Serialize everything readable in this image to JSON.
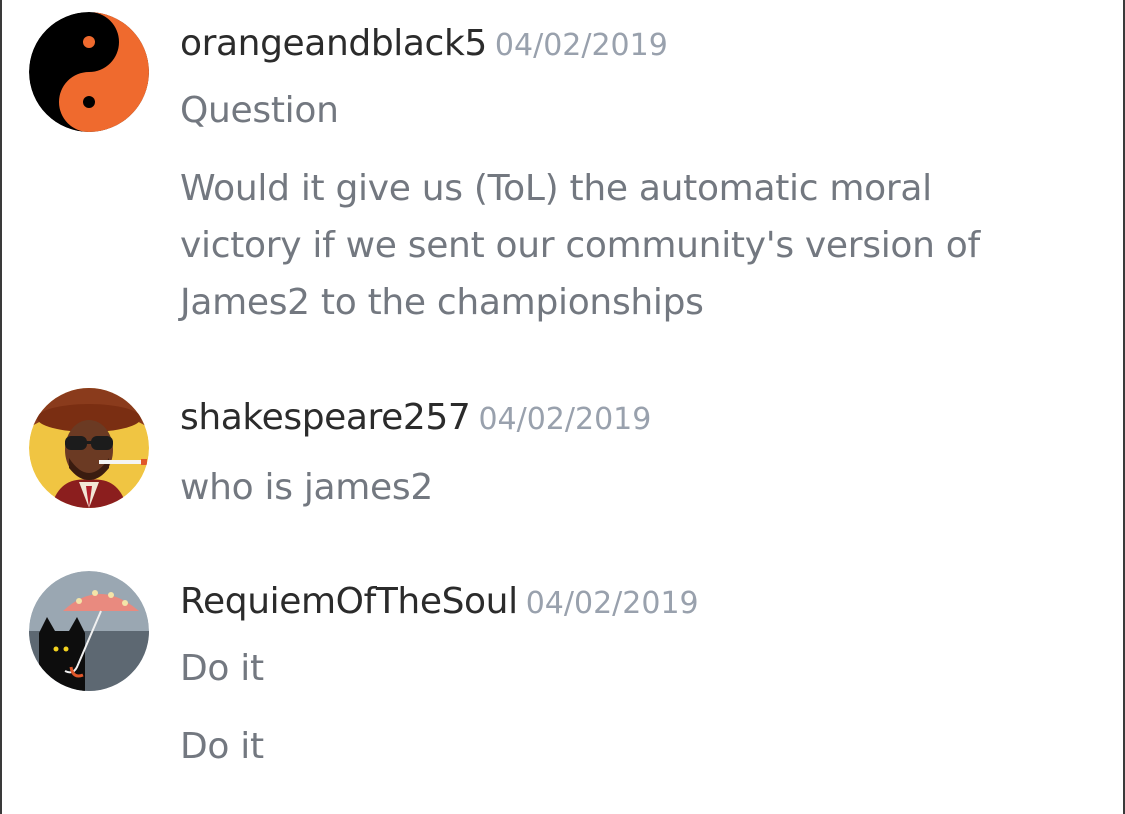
{
  "messages": [
    {
      "username": "orangeandblack5",
      "timestamp": "04/02/2019",
      "avatar_icon": "yin-yang-orange-black",
      "lines": [
        "Question",
        "Would it give us (ToL) the automatic moral victory if we sent our community's version of James2 to the championships"
      ]
    },
    {
      "username": "shakespeare257",
      "timestamp": "04/02/2019",
      "avatar_icon": "man-with-sunglasses-cigarette",
      "lines": [
        "who is james2"
      ]
    },
    {
      "username": "RequiemOfTheSoul",
      "timestamp": "04/02/2019",
      "avatar_icon": "cat-with-umbrella",
      "lines": [
        "Do it",
        "Do it"
      ]
    }
  ]
}
